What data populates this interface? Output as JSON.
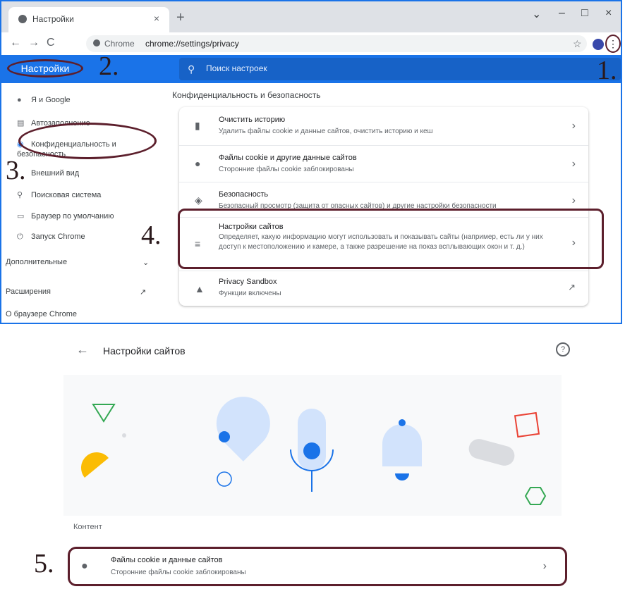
{
  "browser": {
    "tab_title": "Настройки",
    "url_site": "Chrome",
    "url_path": "chrome://settings/privacy"
  },
  "header": {
    "brand": "Настройки",
    "search_placeholder": "Поиск настроек"
  },
  "sidebar": {
    "items": [
      {
        "label": "Я и Google",
        "icon": "person-icon"
      },
      {
        "label": "Автозаполнение",
        "icon": "autofill-icon"
      },
      {
        "label": "Конфиденциальность и безопасность",
        "icon": "shield-icon"
      },
      {
        "label": "Внешний вид",
        "icon": "palette-icon"
      },
      {
        "label": "Поисковая система",
        "icon": "search-icon"
      },
      {
        "label": "Браузер по умолчанию",
        "icon": "browser-icon"
      },
      {
        "label": "Запуск Chrome",
        "icon": "power-icon"
      }
    ],
    "advanced": "Дополнительные",
    "extensions": "Расширения",
    "about": "О браузере Chrome"
  },
  "main": {
    "section_title": "Конфиденциальность и безопасность",
    "rows": [
      {
        "title": "Очистить историю",
        "subtitle": "Удалить файлы cookie и данные сайтов, очистить историю и кеш"
      },
      {
        "title": "Файлы cookie и другие данные сайтов",
        "subtitle": "Сторонние файлы cookie заблокированы"
      },
      {
        "title": "Безопасность",
        "subtitle": "Безопасный просмотр (защита от опасных сайтов) и другие настройки безопасности"
      },
      {
        "title": "Настройки сайтов",
        "subtitle": "Определяет, какую информацию могут использовать и показывать сайты (например, есть ли у них доступ к местоположению и камере, а также разрешение на показ всплывающих окон и т. д.)"
      },
      {
        "title": "Privacy Sandbox",
        "subtitle": "Функции включены"
      }
    ]
  },
  "site_settings": {
    "title": "Настройки сайтов",
    "content_label": "Контент",
    "row_title": "Файлы cookie и данные сайтов",
    "row_subtitle": "Сторонние файлы cookie заблокированы"
  },
  "annotations": {
    "a1": "1.",
    "a2": "2.",
    "a3": "3.",
    "a4": "4.",
    "a5": "5."
  },
  "colors": {
    "accent": "#1a73e8",
    "highlight": "#5c1f2c"
  }
}
